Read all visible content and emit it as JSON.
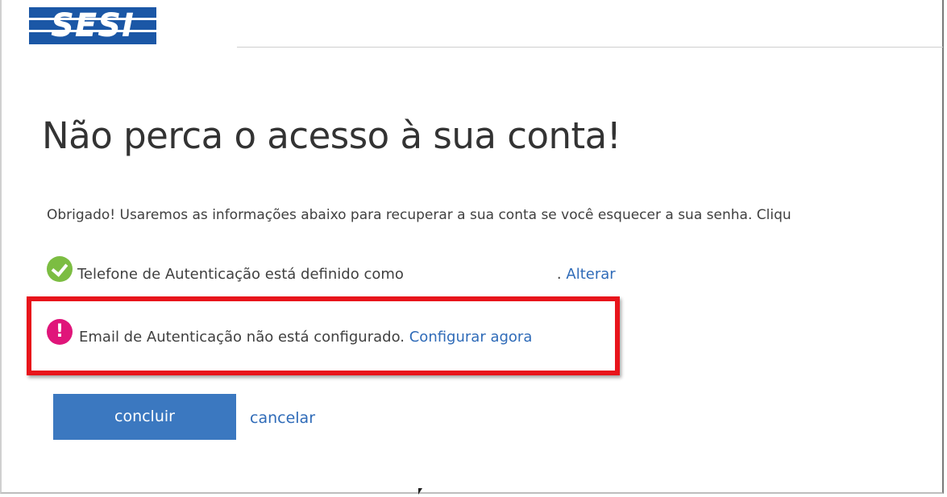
{
  "brand": {
    "logo_text": "SESI",
    "logo_color": "#1b57a6"
  },
  "page": {
    "title": "Não perca o acesso à sua conta!",
    "intro": "Obrigado! Usaremos as informações abaixo para recuperar a sua conta se você esquecer a sua senha. Cliqu"
  },
  "phone_method": {
    "icon": "checkmark-circle-icon",
    "status_color": "#7cbd42",
    "label": "Telefone de Autenticação está definido como",
    "separator": ".",
    "action_label": "Alterar"
  },
  "email_method": {
    "icon": "alert-circle-icon",
    "icon_glyph": "!",
    "status_color": "#e0157a",
    "label": "Email de Autenticação não está configurado.",
    "action_label": "Configurar agora"
  },
  "annotation": {
    "highlight_color": "#e8141b"
  },
  "actions": {
    "finish_label": "concluir",
    "cancel_label": "cancelar",
    "button_color": "#3b78c0",
    "link_color": "#2f6bb8"
  }
}
